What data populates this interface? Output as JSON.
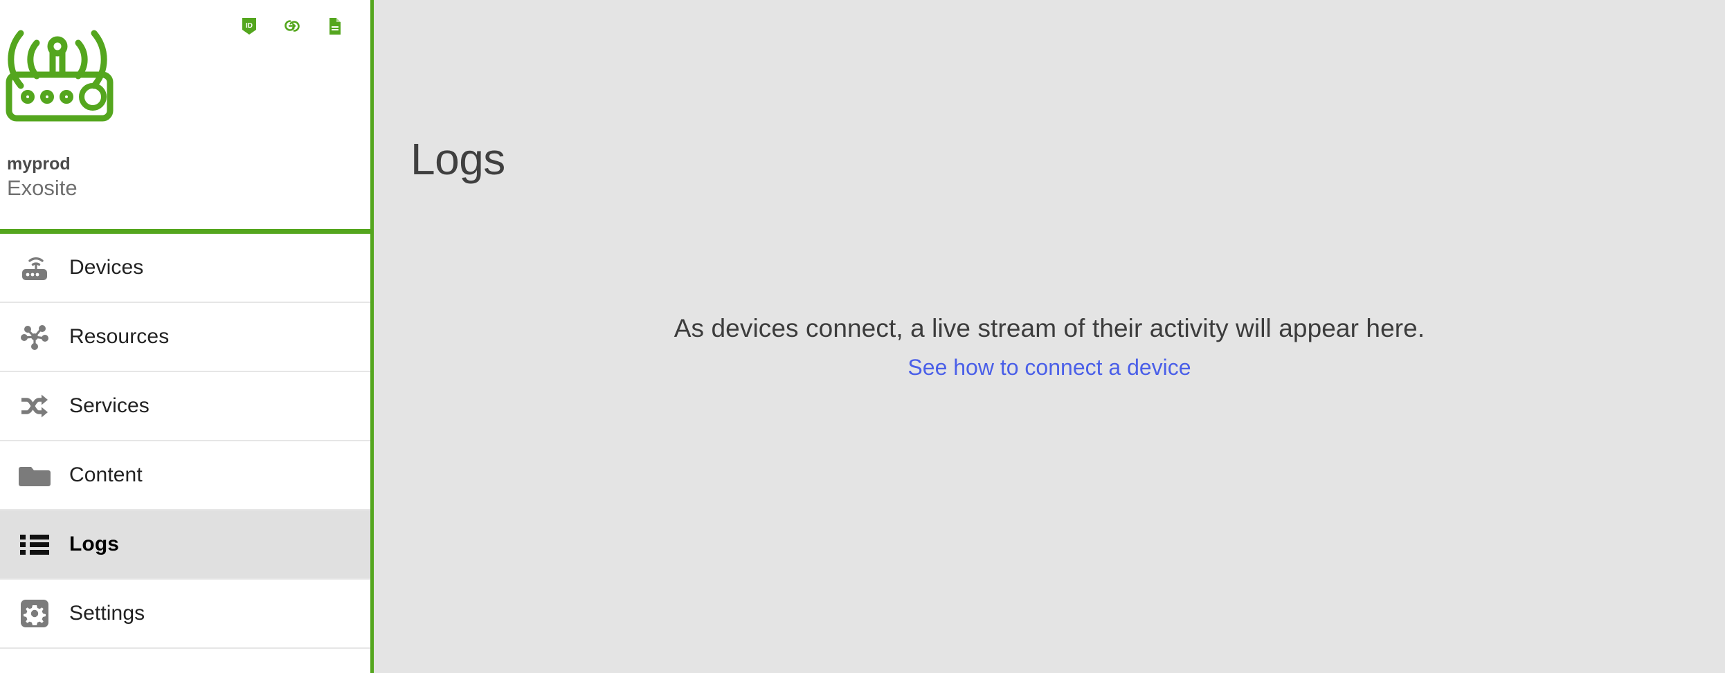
{
  "brand": {
    "logo_icon": "router-gateway-icon",
    "product_name": "myprod",
    "organization": "Exosite",
    "quick_actions": [
      {
        "icon": "id-badge-icon",
        "name": "product-id"
      },
      {
        "icon": "link-chain-icon",
        "name": "product-link"
      },
      {
        "icon": "document-icon",
        "name": "product-docs"
      }
    ]
  },
  "sidebar": {
    "items": [
      {
        "label": "Devices",
        "icon": "router-icon",
        "active": false
      },
      {
        "label": "Resources",
        "icon": "hub-nodes-icon",
        "active": false
      },
      {
        "label": "Services",
        "icon": "shuffle-icon",
        "active": false
      },
      {
        "label": "Content",
        "icon": "folder-icon",
        "active": false
      },
      {
        "label": "Logs",
        "icon": "list-icon",
        "active": true
      },
      {
        "label": "Settings",
        "icon": "gear-icon",
        "active": false
      }
    ]
  },
  "main": {
    "page_title": "Logs",
    "empty_message": "As devices connect, a live stream of their activity will appear here.",
    "empty_link": "See how to connect a device"
  },
  "colors": {
    "brand_green": "#54a61e",
    "link_blue": "#4a5fe8",
    "main_bg": "#e4e4e4",
    "active_row_bg": "#e0e0e0"
  }
}
